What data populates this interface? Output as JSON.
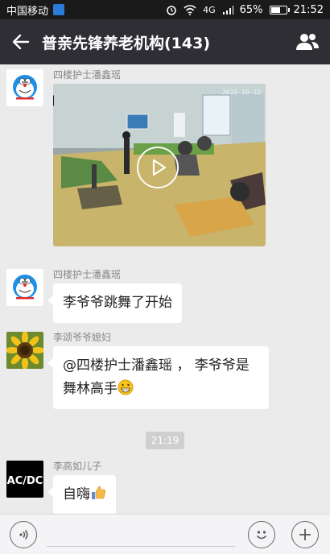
{
  "status_bar": {
    "carrier": "中国移动",
    "network": "4G",
    "battery_percent": "65%",
    "battery_level": 0.65,
    "time": "21:52"
  },
  "title_bar": {
    "title": "普亲先锋养老机构(143)",
    "back_icon": "arrow-left-icon",
    "members_icon": "group-members-icon"
  },
  "messages": [
    {
      "sender": "四楼护士潘鑫瑶",
      "type": "video",
      "video_timestamp": "2016-10-12",
      "play_icon": "play-icon"
    },
    {
      "sender": "四楼护士潘鑫瑶",
      "type": "text",
      "text": "李爷爷跳舞了开始"
    },
    {
      "sender": "李颂爷爷媳妇",
      "type": "text",
      "line1": "@四楼护士潘鑫瑶 ， 李爷爷是",
      "line2": "舞林高手",
      "emoji": "grinning-emoji"
    },
    {
      "sender": "李高如儿子",
      "type": "text",
      "text": "自嗨",
      "emoji": "thumbs-up-emoji"
    }
  ],
  "time_separator": "21:19",
  "input_bar": {
    "voice_icon": "voice-icon",
    "emoji_icon": "smiley-icon",
    "more_icon": "plus-icon"
  },
  "avatars": {
    "nurse": "doraemon-avatar",
    "wife": "sunflower-avatar",
    "son": "acdc-logo-avatar",
    "son_logo_text": "AC/DC"
  },
  "colors": {
    "title_bar": "#2e2e34",
    "chat_background": "#ebebeb",
    "bubble": "#ffffff"
  }
}
